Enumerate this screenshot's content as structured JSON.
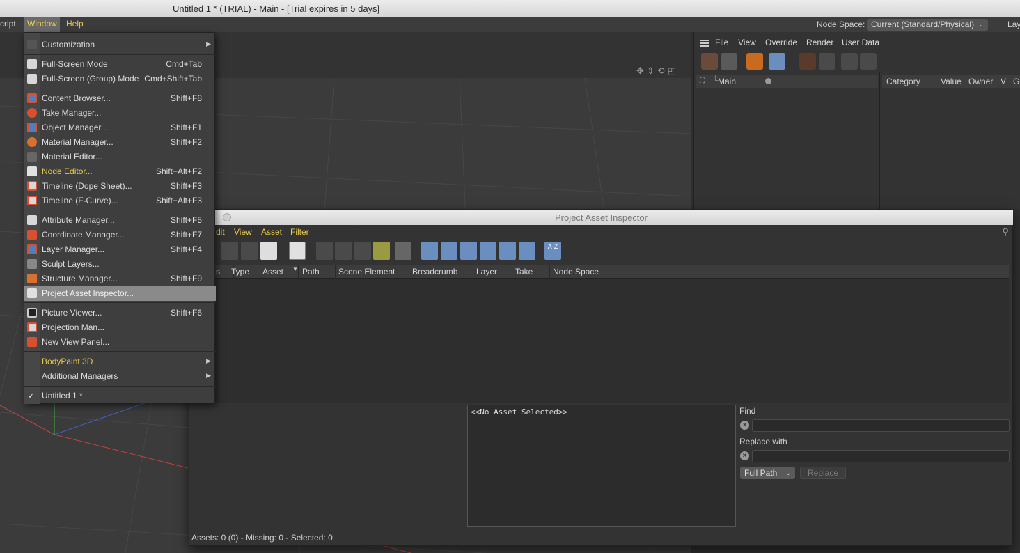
{
  "window": {
    "title": "Untitled 1 * (TRIAL) - Main - [Trial expires in 5 days]"
  },
  "menubar": {
    "items": [
      {
        "label": "cript"
      },
      {
        "label": "Window"
      },
      {
        "label": "Help"
      }
    ],
    "node_space_label": "Node Space:",
    "node_space_value": "Current (Standard/Physical)",
    "layout_label": "Lay"
  },
  "window_menu": {
    "items": [
      {
        "label": "Customization",
        "shortcut": ""
      },
      {
        "label": "Full-Screen Mode",
        "shortcut": "Cmd+Tab"
      },
      {
        "label": "Full-Screen (Group) Mode",
        "shortcut": "Cmd+Shift+Tab"
      },
      {
        "label": "Content Browser...",
        "shortcut": "Shift+F8"
      },
      {
        "label": "Take Manager...",
        "shortcut": ""
      },
      {
        "label": "Object Manager...",
        "shortcut": "Shift+F1"
      },
      {
        "label": "Material Manager...",
        "shortcut": "Shift+F2"
      },
      {
        "label": "Material Editor...",
        "shortcut": ""
      },
      {
        "label": "Node Editor...",
        "shortcut": "Shift+Alt+F2"
      },
      {
        "label": "Timeline (Dope Sheet)...",
        "shortcut": "Shift+F3"
      },
      {
        "label": "Timeline (F-Curve)...",
        "shortcut": "Shift+Alt+F3"
      },
      {
        "label": "Attribute Manager...",
        "shortcut": "Shift+F5"
      },
      {
        "label": "Coordinate Manager...",
        "shortcut": "Shift+F7"
      },
      {
        "label": "Layer Manager...",
        "shortcut": "Shift+F4"
      },
      {
        "label": "Sculpt Layers...",
        "shortcut": ""
      },
      {
        "label": "Structure Manager...",
        "shortcut": "Shift+F9"
      },
      {
        "label": "Project Asset Inspector...",
        "shortcut": ""
      },
      {
        "label": "Picture Viewer...",
        "shortcut": "Shift+F6"
      },
      {
        "label": "Projection Man...",
        "shortcut": ""
      },
      {
        "label": "New View Panel...",
        "shortcut": ""
      },
      {
        "label": "BodyPaint 3D",
        "shortcut": ""
      },
      {
        "label": "Additional Managers",
        "shortcut": ""
      },
      {
        "label": "Untitled 1 *",
        "shortcut": ""
      }
    ],
    "highlighted": "Project Asset Inspector...",
    "checked_mark": "✓",
    "submenu_arrow": "▶"
  },
  "right_panel": {
    "menu": [
      "File",
      "View",
      "Override",
      "Render",
      "User Data"
    ],
    "tree_root": "Main",
    "columns": [
      "Category",
      "Value",
      "Owner",
      "V",
      "Gr"
    ]
  },
  "asset_inspector": {
    "title": "Project Asset Inspector",
    "menu": [
      "dit",
      "View",
      "Asset",
      "Filter"
    ],
    "columns": [
      "s",
      "Type",
      "Asset",
      "Path",
      "Scene Element",
      "Breadcrumb",
      "Layer",
      "Take",
      "Node Space"
    ],
    "sort_indicator": "▼",
    "preview_text": "<<No Asset Selected>>",
    "find_label": "Find",
    "replace_label": "Replace with",
    "clear_glyph": "×",
    "mode_value": "Full Path",
    "replace_button": "Replace",
    "status": "Assets: 0 (0) - Missing: 0 - Selected: 0",
    "az_label": "A-Z"
  },
  "colors": {
    "accent_yellow": "#e8c84a",
    "highlight_grey": "#8a8a8a",
    "panel_bg": "#333333"
  }
}
